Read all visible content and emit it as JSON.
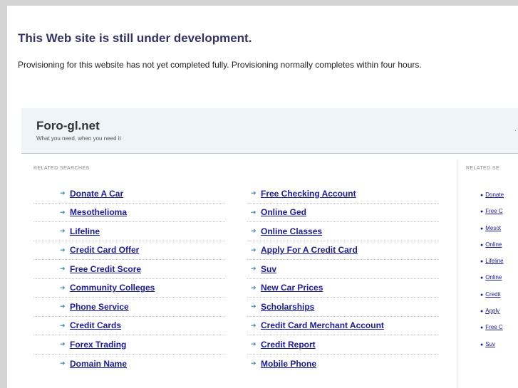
{
  "notice": {
    "title": "This Web site is still under development.",
    "text": "Provisioning for this website has not yet completed fully. Provisioning normally completes within four hours."
  },
  "site": {
    "name": "Foro-gl.net",
    "tagline": "What you need, when you need it"
  },
  "related": {
    "label": "RELATED SEARCHES",
    "side_label": "RELATED SE",
    "column_a": [
      "Donate A Car",
      "Mesothelioma",
      "Lifeline",
      "Credit Card Offer",
      "Free Credit Score",
      "Community Colleges",
      "Phone Service",
      "Credit Cards",
      "Forex Trading",
      "Domain Name"
    ],
    "column_b": [
      "Free Checking Account",
      "Online Ged",
      "Online Classes",
      "Apply For A Credit Card",
      "Suv",
      "New Car Prices",
      "Scholarships",
      "Credit Card Merchant Account",
      "Credit Report",
      "Mobile Phone"
    ],
    "side": [
      "Donate",
      "Free C",
      "Mesot",
      "Online",
      "Lifeline",
      "Online",
      "Credit",
      "Apply",
      "Free C",
      "Suv"
    ]
  }
}
